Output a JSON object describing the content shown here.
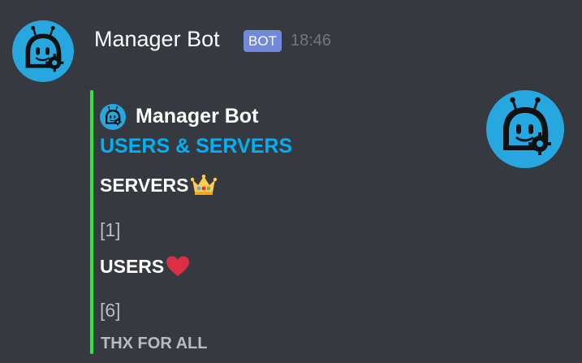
{
  "message": {
    "author": "Manager Bot",
    "bot_tag": "BOT",
    "timestamp": "18:46",
    "avatar_icon": "robot-avatar-icon",
    "accent_color": "#27a7e0"
  },
  "embed": {
    "border_color": "#2ee63c",
    "author_name": "Manager Bot",
    "title": "USERS & SERVERS",
    "fields": [
      {
        "name": "SERVERS",
        "emoji": "crown-emoji",
        "value": "[1]"
      },
      {
        "name": "USERS",
        "emoji": "red-heart-emoji",
        "value": "[6]"
      }
    ],
    "footer": "THX FOR ALL",
    "thumbnail_icon": "robot-avatar-icon"
  }
}
